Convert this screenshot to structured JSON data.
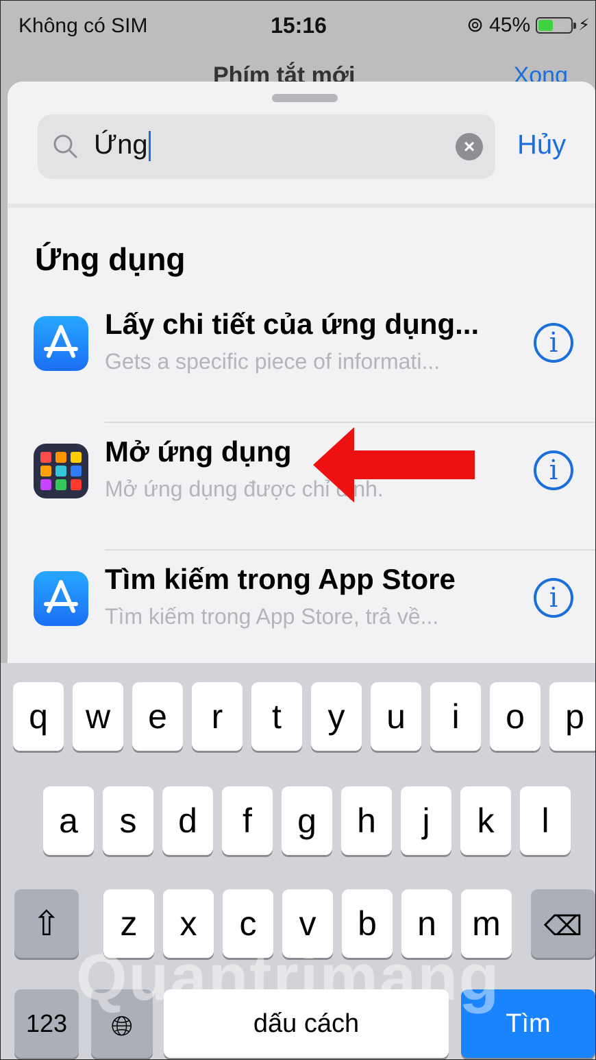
{
  "status_bar": {
    "carrier": "Không có SIM",
    "time": "15:16",
    "battery": "45%",
    "battery_level": 0.45
  },
  "behind": {
    "title": "Phím tắt mới",
    "right_button": "Xong"
  },
  "search": {
    "query": "Ứng",
    "cancel_label": "Hủy"
  },
  "section_title": "Ứng dụng",
  "results": [
    {
      "title": "Lấy chi tiết của ứng dụng...",
      "subtitle": "Gets a specific piece of informati...",
      "icon": "app-store-icon"
    },
    {
      "title": "Mở ứng dụng",
      "subtitle": "Mở ứng dụng được chỉ định.",
      "icon": "open-app-icon"
    },
    {
      "title": "Tìm kiếm trong App Store",
      "subtitle": "Tìm kiếm trong App Store, trả về...",
      "icon": "app-store-icon"
    }
  ],
  "keyboard": {
    "row1": [
      "q",
      "w",
      "e",
      "r",
      "t",
      "y",
      "u",
      "i",
      "o",
      "p"
    ],
    "row2": [
      "a",
      "s",
      "d",
      "f",
      "g",
      "h",
      "j",
      "k",
      "l"
    ],
    "row3": [
      "z",
      "x",
      "c",
      "v",
      "b",
      "n",
      "m"
    ],
    "numbers_label": "123",
    "space_label": "dấu cách",
    "return_label": "Tìm"
  },
  "watermark": "Quantrimang",
  "colors": {
    "accent": "#1a6fdc",
    "key_blue": "#1a84ff",
    "arrow": "#ee1111"
  }
}
